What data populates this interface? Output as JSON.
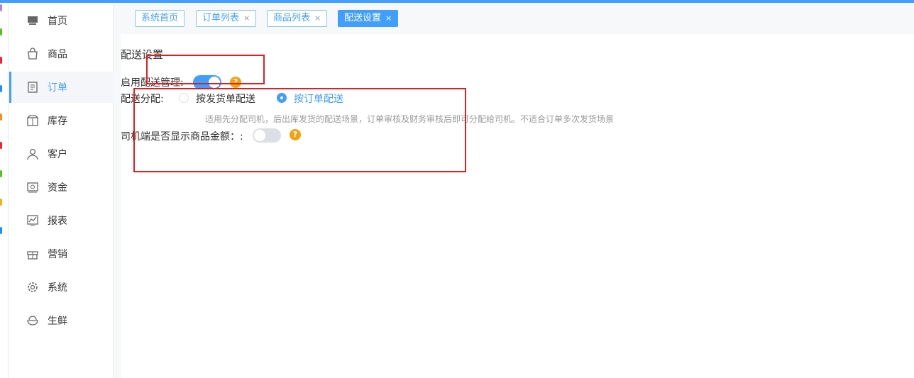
{
  "colors": {
    "primary": "#409eff",
    "help": "#f2a20c",
    "annotation": "#e02020"
  },
  "sidebar": {
    "items": [
      {
        "label": "首页",
        "icon": "home-icon"
      },
      {
        "label": "商品",
        "icon": "shopping-bag-icon"
      },
      {
        "label": "订单",
        "icon": "order-document-icon",
        "active": true
      },
      {
        "label": "库存",
        "icon": "inventory-box-icon"
      },
      {
        "label": "客户",
        "icon": "customer-user-icon"
      },
      {
        "label": "资金",
        "icon": "funds-safe-icon"
      },
      {
        "label": "报表",
        "icon": "report-chart-icon"
      },
      {
        "label": "营销",
        "icon": "marketing-gift-icon"
      },
      {
        "label": "系统",
        "icon": "system-gear-icon"
      },
      {
        "label": "生鲜",
        "icon": "fresh-bowl-icon"
      }
    ]
  },
  "tabs": [
    {
      "label": "系统首页",
      "closable": false
    },
    {
      "label": "订单列表",
      "closable": true
    },
    {
      "label": "商品列表",
      "closable": true
    },
    {
      "label": "配送设置",
      "closable": true,
      "active": true
    }
  ],
  "tab_close_glyph": "×",
  "settings": {
    "title": "配送设置",
    "enable_delivery": {
      "label": "启用配送管理:",
      "on": true
    },
    "assignment": {
      "label": "配送分配:",
      "options": [
        {
          "label": "按发货单配送",
          "checked": false
        },
        {
          "label": "按订单配送",
          "checked": true
        }
      ],
      "hint": "适用先分配司机，后出库发货的配送场景，订单审核及财务审核后即可分配给司机。不适合订单多次发货场景"
    },
    "driver_show_amount": {
      "label": "司机端是否显示商品金额：:",
      "on": false
    },
    "help_glyph": "?"
  }
}
